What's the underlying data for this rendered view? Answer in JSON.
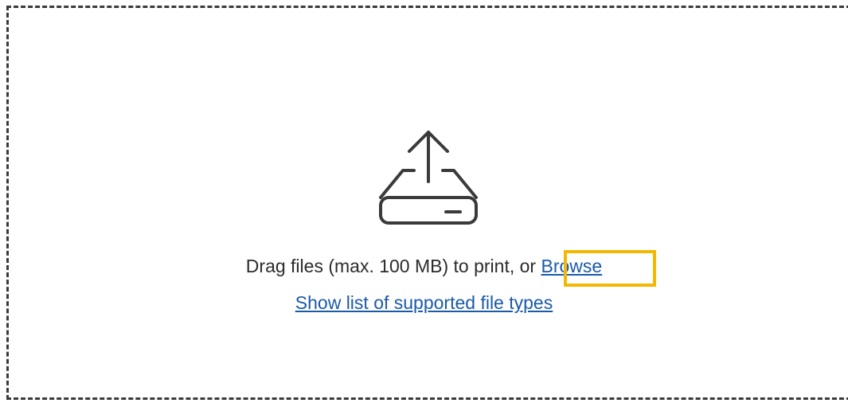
{
  "dropzone": {
    "icon": "upload-tray-icon",
    "instruction_text": "Drag files (max. 100 MB) to print, or",
    "browse_label": "Browse",
    "supported_types_label": "Show list of supported file types"
  },
  "colors": {
    "link": "#1a5aa8",
    "highlight": "#f5b800",
    "border": "#3a3a3a",
    "text": "#2b2b2b"
  }
}
